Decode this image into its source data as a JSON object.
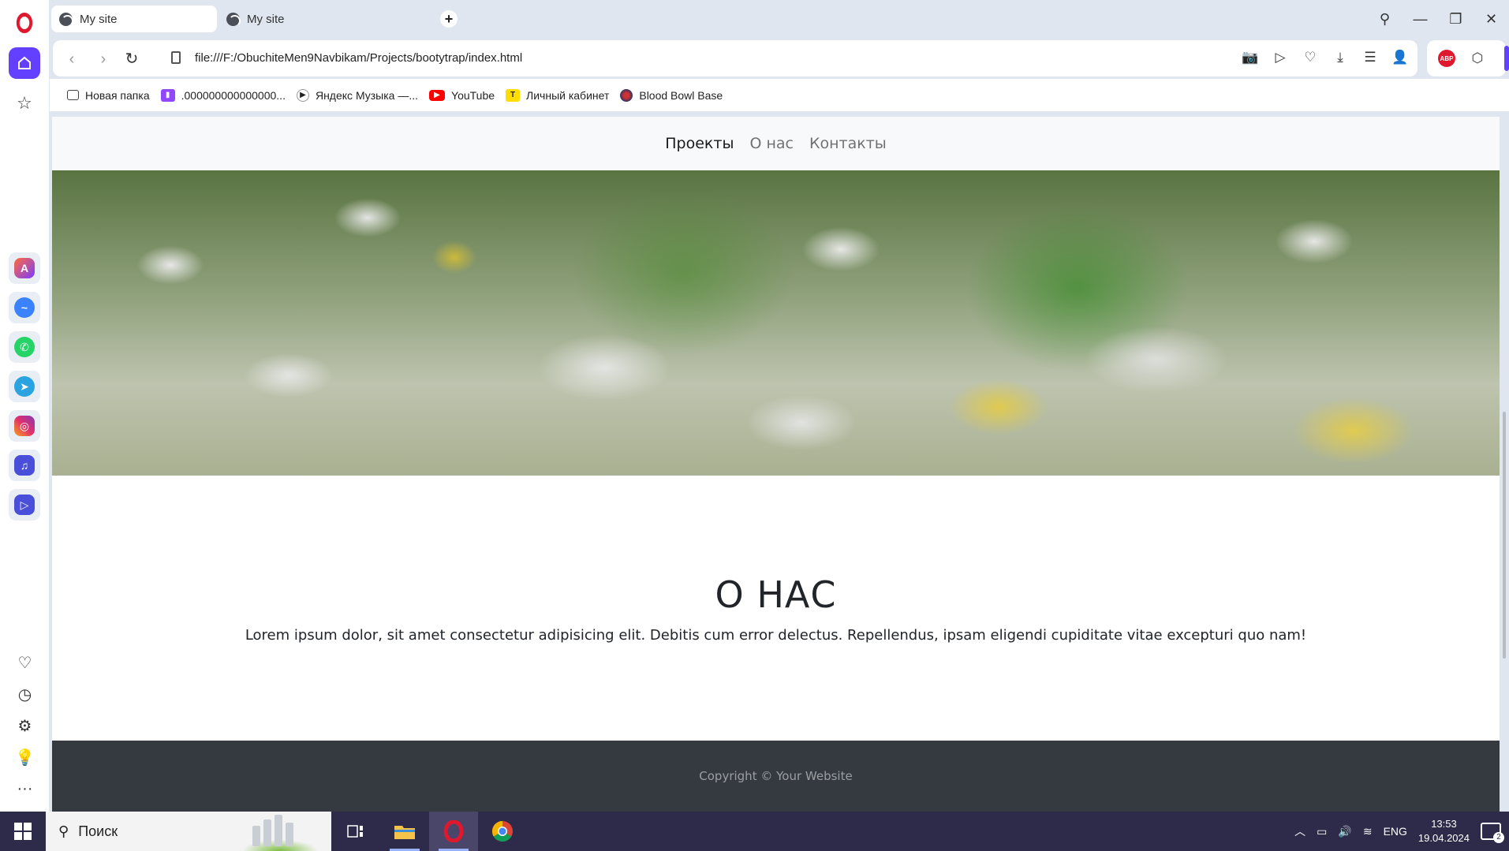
{
  "browser": {
    "tabs": [
      {
        "title": "My site",
        "active": true
      },
      {
        "title": "My site",
        "active": false
      }
    ],
    "new_tab": "+",
    "address": "file:///F:/ObuchiteMen9Navbikam/Projects/bootytrap/index.html",
    "bookmarks": [
      {
        "label": "Новая папка",
        "icon": "folder-icon"
      },
      {
        "label": ".000000000000000...",
        "icon": "twitch-icon"
      },
      {
        "label": "Яндекс Музыка —...",
        "icon": "play-icon"
      },
      {
        "label": "YouTube",
        "icon": "youtube-icon"
      },
      {
        "label": "Личный кабинет",
        "icon": "t-icon"
      },
      {
        "label": "Blood Bowl Base",
        "icon": "bloodbowl-icon"
      }
    ],
    "extension_label": "ABP"
  },
  "site": {
    "nav": [
      {
        "label": "Проекты",
        "active": true
      },
      {
        "label": "О нас",
        "active": false
      },
      {
        "label": "Контакты",
        "active": false
      }
    ],
    "about": {
      "heading": "О НАС",
      "text": "Lorem ipsum dolor, sit amet consectetur adipisicing elit. Debitis cum error delectus. Repellendus, ipsam eligendi cupiditate vitae excepturi quo nam!"
    },
    "footer": "Copyright © Your Website"
  },
  "taskbar": {
    "search_label": "Поиск",
    "language": "ENG",
    "time": "13:53",
    "date": "19.04.2024",
    "notifications": "2"
  },
  "colors": {
    "opera_red": "#e0182d",
    "opera_purple": "#6340ff",
    "footer_bg": "#343a40",
    "navbar_bg": "#f8f9fa"
  }
}
